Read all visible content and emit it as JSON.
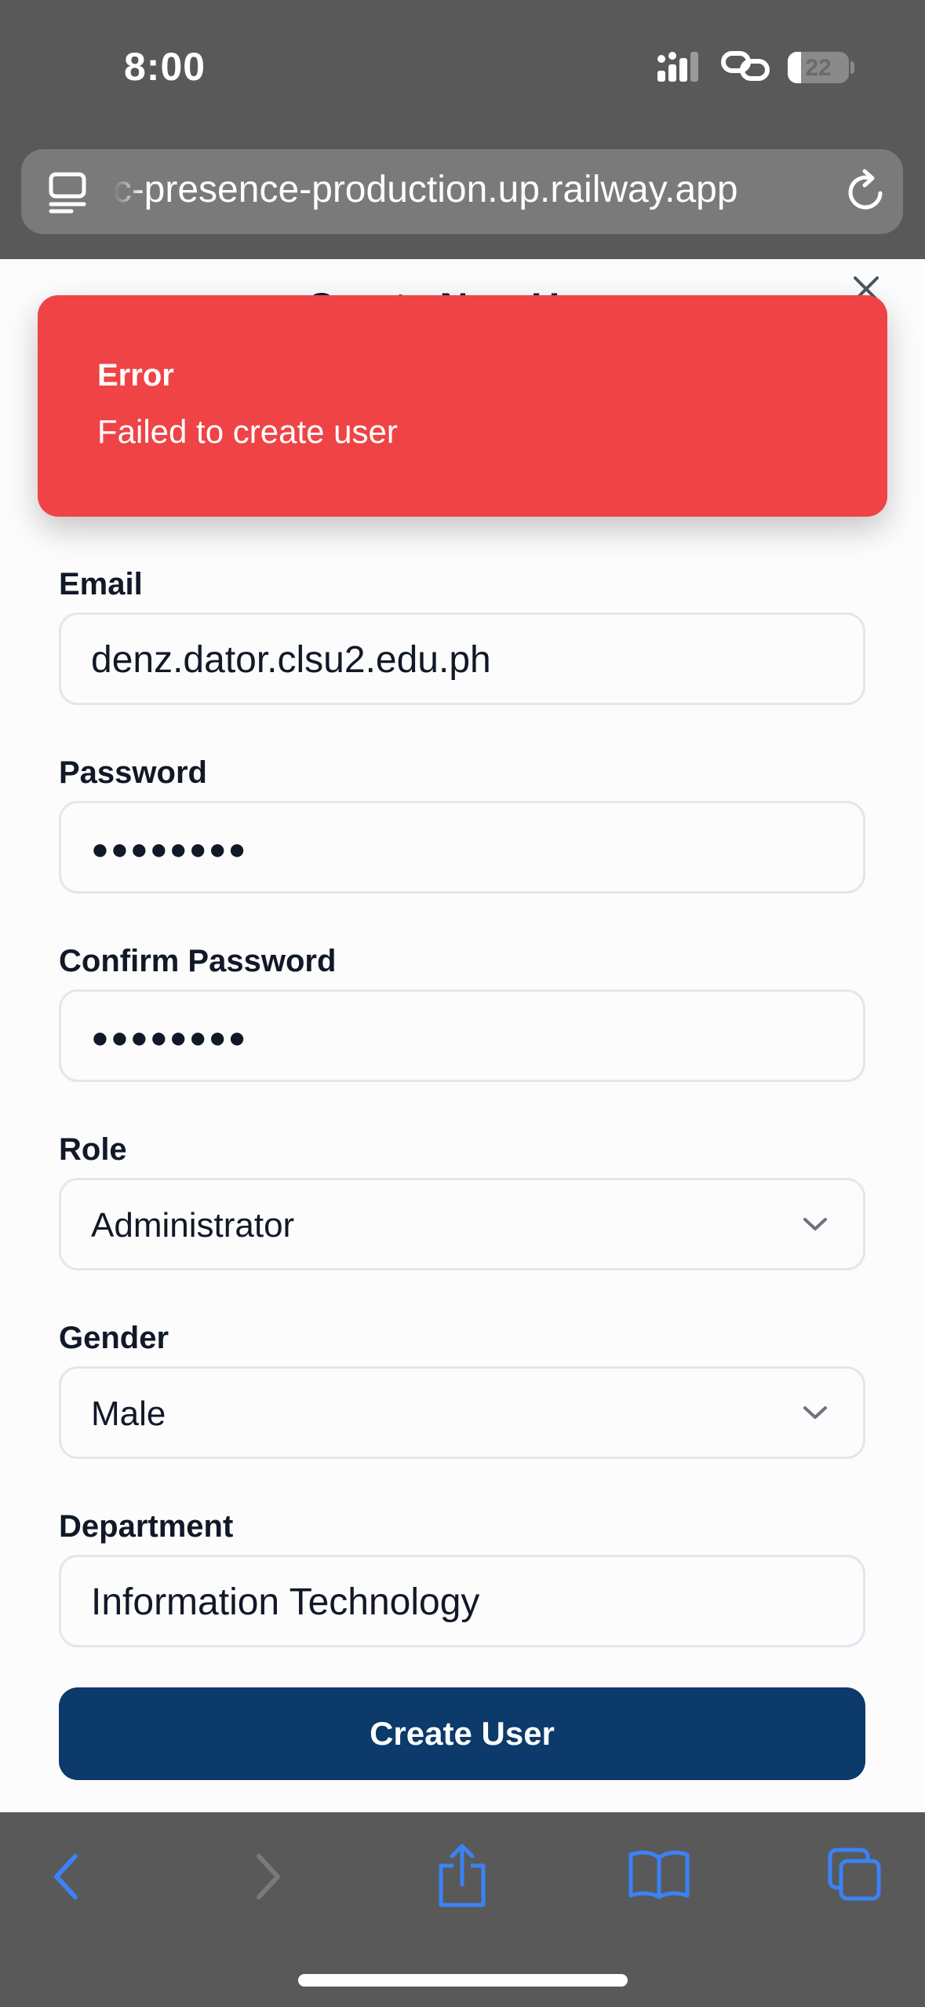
{
  "status_bar": {
    "time": "8:00",
    "battery_level": "22",
    "battery_fraction": 0.22,
    "icons": [
      "signal-icon",
      "link-icon",
      "battery-icon"
    ]
  },
  "browser": {
    "url": "ec-presence-production.up.railway.app",
    "icons": [
      "page-menu-icon",
      "reload-icon"
    ]
  },
  "modal": {
    "title": "Create New User",
    "close_icon": "close-icon",
    "fields": {
      "email": {
        "label": "Email",
        "value": "denz.dator.clsu2.edu.ph"
      },
      "password": {
        "label": "Password",
        "value": "●●●●●●●●"
      },
      "confirm_password": {
        "label": "Confirm Password",
        "value": "●●●●●●●●"
      },
      "role": {
        "label": "Role",
        "value": "Administrator"
      },
      "gender": {
        "label": "Gender",
        "value": "Male"
      },
      "department": {
        "label": "Department",
        "value": "Information Technology"
      }
    },
    "submit_label": "Create User"
  },
  "toast": {
    "title": "Error",
    "message": "Failed to create user",
    "color": "#ef4346"
  },
  "toolbar": {
    "icons": [
      "back-icon",
      "forward-icon",
      "share-icon",
      "bookmarks-icon",
      "tabs-icon"
    ]
  },
  "colors": {
    "accent": "#0b3a6b",
    "browser_icon": "#3b82f6",
    "error": "#ef4346"
  }
}
